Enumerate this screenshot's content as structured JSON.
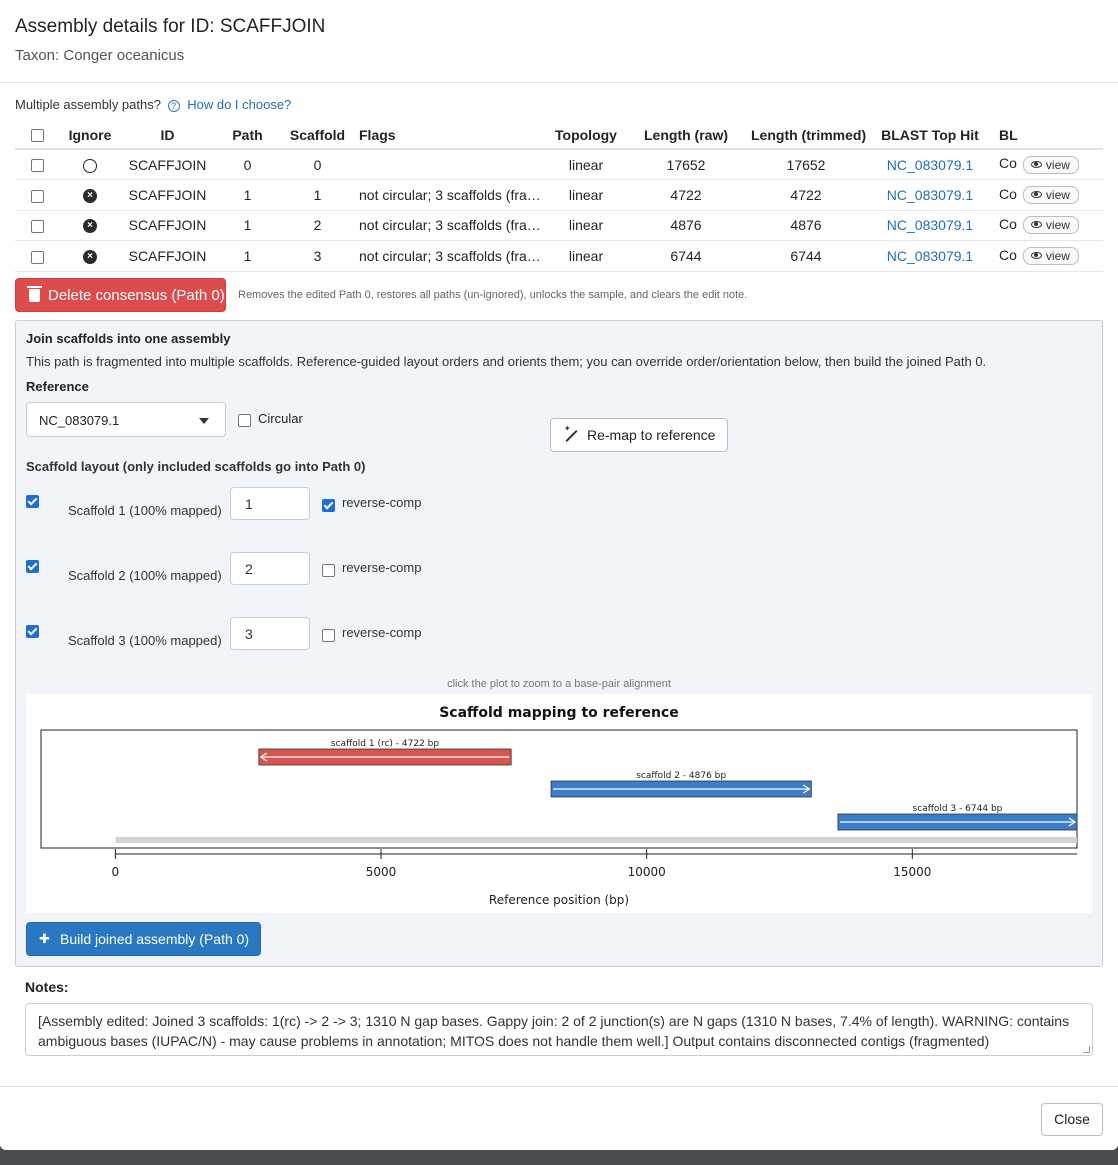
{
  "header": {
    "title": "Assembly details for ID: SCAFFJOIN",
    "taxon": "Taxon: Conger oceanicus"
  },
  "paths_help": {
    "question": "Multiple assembly paths?",
    "help_icon": "question-circle-icon",
    "link": "How do I choose?"
  },
  "table": {
    "columns": [
      "Ignore",
      "ID",
      "Path",
      "Scaffold",
      "Flags",
      "Topology",
      "Length (raw)",
      "Length (trimmed)",
      "BLAST Top Hit",
      "BL"
    ],
    "rows": [
      {
        "ignored": false,
        "id": "SCAFFJOIN",
        "path": "0",
        "scaffold": "0",
        "flags": "",
        "topology": "linear",
        "len_raw": "17652",
        "len_trim": "17652",
        "blast": "NC_083079.1",
        "bl": "Co"
      },
      {
        "ignored": true,
        "id": "SCAFFJOIN",
        "path": "1",
        "scaffold": "1",
        "flags": "not circular; 3 scaffolds (fra…",
        "topology": "linear",
        "len_raw": "4722",
        "len_trim": "4722",
        "blast": "NC_083079.1",
        "bl": "Co"
      },
      {
        "ignored": true,
        "id": "SCAFFJOIN",
        "path": "1",
        "scaffold": "2",
        "flags": "not circular; 3 scaffolds (fra…",
        "topology": "linear",
        "len_raw": "4876",
        "len_trim": "4876",
        "blast": "NC_083079.1",
        "bl": "Co"
      },
      {
        "ignored": true,
        "id": "SCAFFJOIN",
        "path": "1",
        "scaffold": "3",
        "flags": "not circular; 3 scaffolds (fra…",
        "topology": "linear",
        "len_raw": "6744",
        "len_trim": "6744",
        "blast": "NC_083079.1",
        "bl": "Co"
      }
    ],
    "view_label": "view"
  },
  "delete": {
    "label": "Delete consensus (Path 0)",
    "note": "Removes the edited Path 0, restores all paths (un-ignored), unlocks the sample, and clears the edit note.",
    "color": "#dc4c4c"
  },
  "join": {
    "title": "Join scaffolds into one assembly",
    "description": "This path is fragmented into multiple scaffolds. Reference-guided layout orders and orients them; you can override order/orientation below, then build the joined Path 0.",
    "reference_label": "Reference",
    "reference_value": "NC_083079.1",
    "circular_label": "Circular",
    "circular_checked": false,
    "remap_label": "Re-map to reference",
    "layout_label": "Scaffold layout (only included scaffolds go into Path 0)",
    "reverse_label": "reverse-comp",
    "scaffolds": [
      {
        "name": "Scaffold 1 (100% mapped)",
        "included": true,
        "order": "1",
        "reverse": true
      },
      {
        "name": "Scaffold 2 (100% mapped)",
        "included": true,
        "order": "2",
        "reverse": false
      },
      {
        "name": "Scaffold 3 (100% mapped)",
        "included": true,
        "order": "3",
        "reverse": false
      }
    ],
    "plot_hint": "click the plot to zoom to a base-pair alignment",
    "build_label": "Build joined assembly (Path 0)",
    "build_color": "#2b78c2"
  },
  "chart_data": {
    "type": "bar",
    "title": "Scaffold mapping to reference",
    "xlabel": "Reference position (bp)",
    "xlim": [
      -1400,
      18100
    ],
    "xticks": [
      0,
      5000,
      10000,
      15000
    ],
    "reference_length": 18100,
    "segments": [
      {
        "label": "scaffold 1 (rc) - 4722 bp",
        "start": 2700,
        "end": 7450,
        "strand": "-",
        "color": "#d9534f"
      },
      {
        "label": "scaffold 2 - 4876 bp",
        "start": 8200,
        "end": 13100,
        "strand": "+",
        "color": "#3a7dc9"
      },
      {
        "label": "scaffold 3 - 6744 bp",
        "start": 13600,
        "end": 18100,
        "strand": "+",
        "color": "#3a7dc9"
      }
    ]
  },
  "notes": {
    "label": "Notes:",
    "text": "[Assembly edited: Joined 3 scaffolds: 1(rc) -> 2 -> 3; 1310 N gap bases. Gappy join: 2 of 2 junction(s) are N gaps (1310 N bases, 7.4% of length). WARNING: contains ambiguous bases (IUPAC/N) - may cause problems in annotation; MITOS does not handle them well.] Output contains disconnected contigs (fragmented)"
  },
  "footer": {
    "close_label": "Close"
  }
}
